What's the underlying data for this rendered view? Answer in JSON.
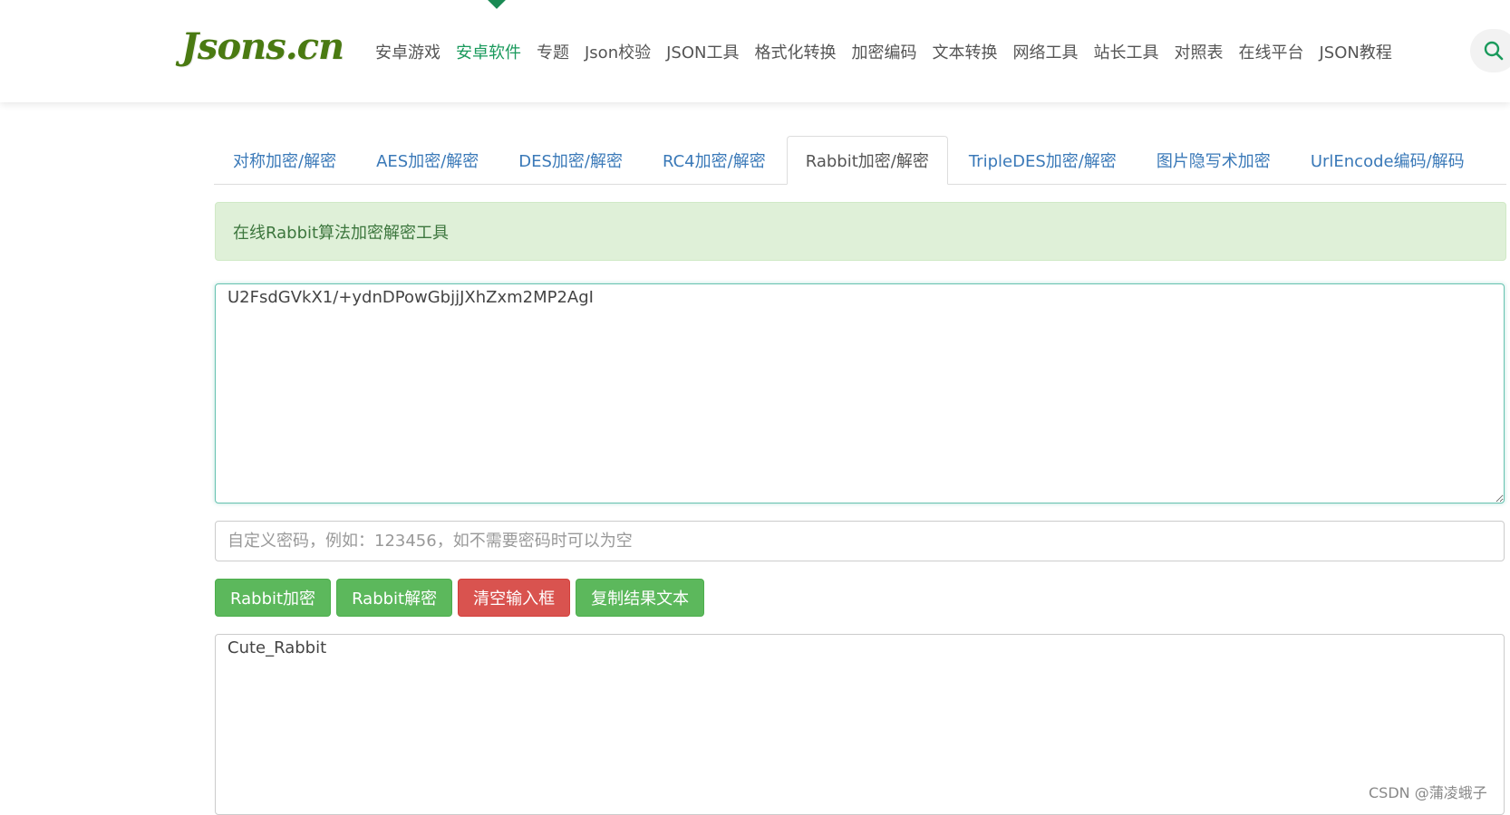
{
  "header": {
    "logo_text": "Jsons.cn",
    "nav": [
      {
        "label": "安卓游戏"
      },
      {
        "label": "安卓软件",
        "active": true
      },
      {
        "label": "专题"
      },
      {
        "label": "Json校验"
      },
      {
        "label": "JSON工具"
      },
      {
        "label": "格式化转换"
      },
      {
        "label": "加密编码"
      },
      {
        "label": "文本转换"
      },
      {
        "label": "网络工具"
      },
      {
        "label": "站长工具"
      },
      {
        "label": "对照表"
      },
      {
        "label": "在线平台"
      },
      {
        "label": "JSON教程"
      }
    ],
    "search_icon": "search-icon"
  },
  "tabs": [
    {
      "label": "对称加密/解密"
    },
    {
      "label": "AES加密/解密"
    },
    {
      "label": "DES加密/解密"
    },
    {
      "label": "RC4加密/解密"
    },
    {
      "label": "Rabbit加密/解密",
      "active": true
    },
    {
      "label": "TripleDES加密/解密"
    },
    {
      "label": "图片隐写术加密"
    },
    {
      "label": "UrlEncode编码/解码"
    }
  ],
  "alert": {
    "text": "在线Rabbit算法加密解密工具"
  },
  "input": {
    "value": "U2FsdGVkX1/+ydnDPowGbjjJXhZxm2MP2AgI"
  },
  "password": {
    "placeholder": "自定义密码，例如：123456，如不需要密码时可以为空"
  },
  "buttons": {
    "encrypt": "Rabbit加密",
    "decrypt": "Rabbit解密",
    "clear": "清空输入框",
    "copy": "复制结果文本"
  },
  "output": {
    "value": "Cute_Rabbit"
  },
  "watermark": {
    "text": "CSDN @蒲凌蛾子"
  },
  "colors": {
    "brand_green": "#4a7a12",
    "nav_active": "#1a9a5c",
    "tab_link": "#3a79b8",
    "btn_green": "#5cb85c",
    "btn_red": "#d9534f",
    "alert_bg": "#dff0d8",
    "alert_text": "#3c763d"
  }
}
